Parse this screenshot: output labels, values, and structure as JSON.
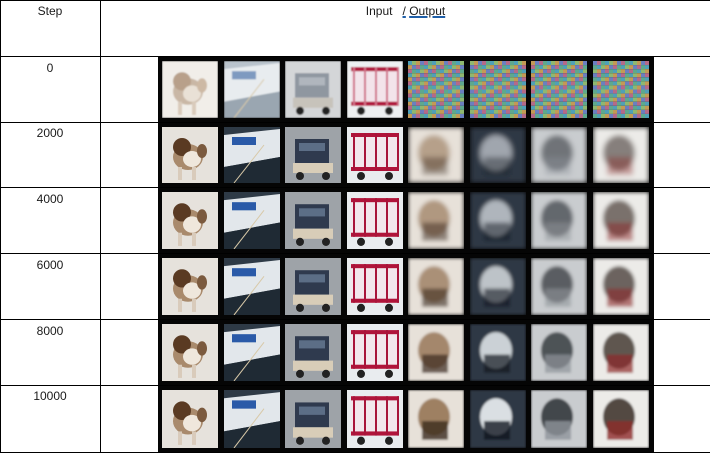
{
  "table": {
    "step_header": "Step",
    "io_header_input": "Input",
    "io_header_sep": "/",
    "io_header_output": "Output"
  },
  "rows": [
    {
      "step": "0"
    },
    {
      "step": "2000"
    },
    {
      "step": "4000"
    },
    {
      "step": "6000"
    },
    {
      "step": "8000"
    },
    {
      "step": "10000"
    }
  ],
  "thumbnails": [
    "dog-image",
    "ship-image",
    "truck-image",
    "red-truck-image"
  ],
  "colors": {
    "grid": "#000000",
    "strip_background": "#050505",
    "underline": "#1f5fa8"
  }
}
